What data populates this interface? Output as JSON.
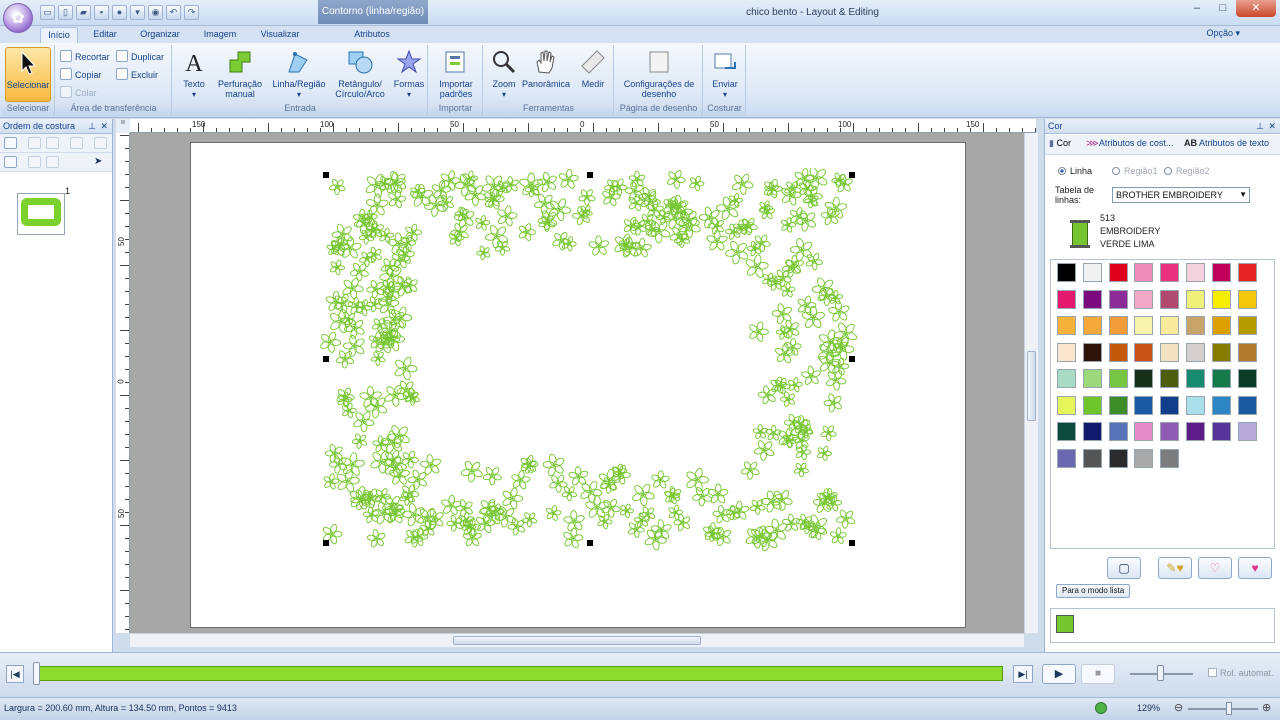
{
  "window": {
    "title": "chico bento - Layout & Editing",
    "context_tab_title": "Contorno (linha/região)",
    "minimize": "–",
    "maximize": "□",
    "close": "✕"
  },
  "tabs": [
    "Início",
    "Editar",
    "Organizar",
    "Imagem",
    "Visualizar",
    "Atributos"
  ],
  "opcao": "Opção",
  "ribbon": {
    "selecionar": {
      "label": "Selecionar",
      "group": "Selecionar"
    },
    "clipboard": {
      "recortar": "Recortar",
      "duplicar": "Duplicar",
      "copiar": "Copiar",
      "excluir": "Excluir",
      "colar": "Colar",
      "group": "Área de transferência"
    },
    "entrada": {
      "texto": "Texto",
      "perfuracao": "Perfuração manual",
      "linha_regiao": "Linha/Região",
      "retangulo": "Retângulo/ Círculo/Arco",
      "formas": "Formas",
      "group": "Entrada"
    },
    "importar": {
      "label": "Importar padrões",
      "group": "Importar"
    },
    "ferramentas": {
      "zoom": "Zoom",
      "panoramica": "Panorâmica",
      "medir": "Medir",
      "group": "Ferramentas"
    },
    "pagina": {
      "label": "Configurações de desenho",
      "group": "Página de desenho"
    },
    "costurar": {
      "label": "Enviar",
      "group": "Costurar"
    }
  },
  "left_panel": {
    "title": "Ordem de costura",
    "thumb_number": "1"
  },
  "rulers": {
    "top_labels": [
      "150",
      "100",
      "50",
      "0",
      "50",
      "100",
      "150"
    ],
    "left_labels": [
      "50",
      "0",
      "50"
    ]
  },
  "right_panel": {
    "title": "Cor",
    "tabs": [
      "Cor",
      "Atributos de cost...",
      "Atributos de texto"
    ],
    "radios": [
      "Linha",
      "Região1",
      "Região2"
    ],
    "tabela_label": "Tabela de linhas:",
    "thread_table": "BROTHER EMBROIDERY",
    "thread_code": "513",
    "thread_brand": "EMBROIDERY",
    "thread_name": "VERDE LIMA",
    "selected_color": "#75c630",
    "palette": [
      "#000000",
      "#f1f1f1",
      "#e0001b",
      "#f08cb8",
      "#e8327e",
      "#f3d2de",
      "#c0005a",
      "#e72323",
      "#e4196e",
      "#7a0a7e",
      "#8c2c96",
      "#f0a8c4",
      "#b04a6e",
      "#eef07a",
      "#f5ee00",
      "#f3c70c",
      "#f4b23a",
      "#f6a83a",
      "#f39c3a",
      "#f7f4ae",
      "#f8ec9c",
      "#c6a46a",
      "#dca000",
      "#b59a00",
      "#fae5cf",
      "#2e1408",
      "#c25a0a",
      "#c8541a",
      "#f3e2c0",
      "#d4cfcf",
      "#857c00",
      "#b27a2c",
      "#a8dcc4",
      "#9ed87c",
      "#76c543",
      "#17301a",
      "#4f5d0e",
      "#178a70",
      "#147a4a",
      "#0b3a25",
      "#e6f55a",
      "#6fc62c",
      "#3c8c28",
      "#1a5aa4",
      "#123e8c",
      "#a8dfea",
      "#2f86c4",
      "#1c5aa2",
      "#0c4a3c",
      "#101a6e",
      "#5672b8",
      "#e38cc8",
      "#8e5cb2",
      "#5c1c8a",
      "#56349a",
      "#b6aad8",
      "#6a68b0",
      "#555555",
      "#2b2b2b",
      "#a9a9a9",
      "#7c7c7c"
    ],
    "list_mode_btn": "Para o modo lista"
  },
  "simulator": {
    "progress": 1.0,
    "auto_scroll": "Rol. automat."
  },
  "status": {
    "text": "Largura = 200.60 mm, Altura = 134.50 mm, Pontos = 9413",
    "zoom": "129%"
  }
}
